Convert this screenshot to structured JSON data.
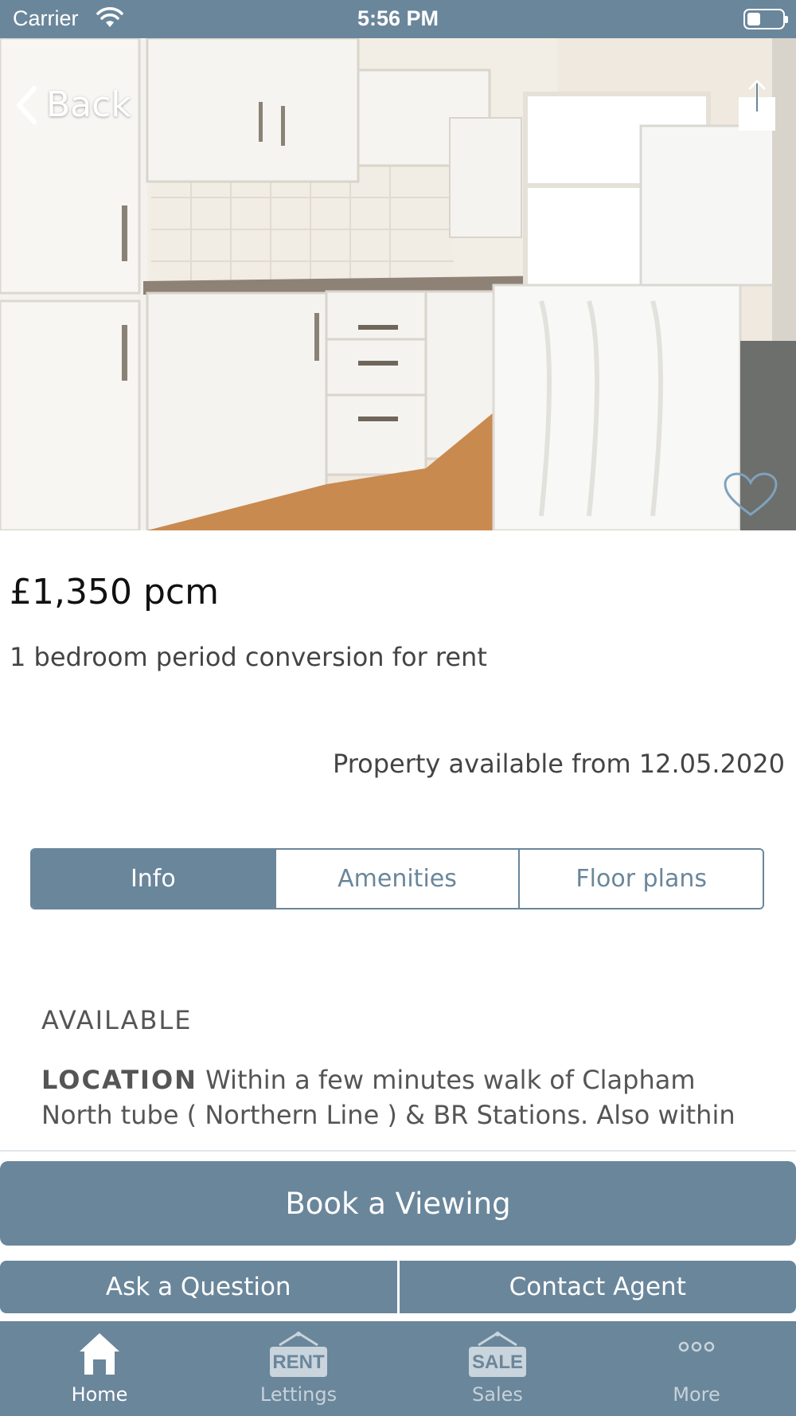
{
  "status_bar": {
    "carrier": "Carrier",
    "time": "5:56 PM"
  },
  "header": {
    "back_label": "Back",
    "share_icon": "share-icon",
    "favorite_icon": "heart-icon"
  },
  "listing": {
    "price": "£1,350 pcm",
    "subtitle": "1 bedroom period conversion for rent",
    "availability": "Property available from 12.05.2020"
  },
  "tabs": [
    {
      "label": "Info",
      "active": true
    },
    {
      "label": "Amenities",
      "active": false
    },
    {
      "label": "Floor plans",
      "active": false
    }
  ],
  "info": {
    "heading": "AVAILABLE",
    "location_label": "LOCATION",
    "location_text": " Within a few minutes walk of Clapham North tube ( Northern Line ) & BR Stations. Also within"
  },
  "actions": {
    "book_viewing": "Book a Viewing",
    "ask_question": "Ask a Question",
    "contact_agent": "Contact Agent"
  },
  "tab_bar": {
    "items": [
      {
        "label": "Home",
        "icon": "home-icon",
        "active": true
      },
      {
        "label": "Lettings",
        "icon": "rent-sign-icon",
        "sign_text": "RENT",
        "active": false
      },
      {
        "label": "Sales",
        "icon": "sale-sign-icon",
        "sign_text": "SALE",
        "active": false
      },
      {
        "label": "More",
        "icon": "more-icon",
        "active": false
      }
    ]
  },
  "colors": {
    "brand": "#6a869b",
    "text": "#444444"
  }
}
